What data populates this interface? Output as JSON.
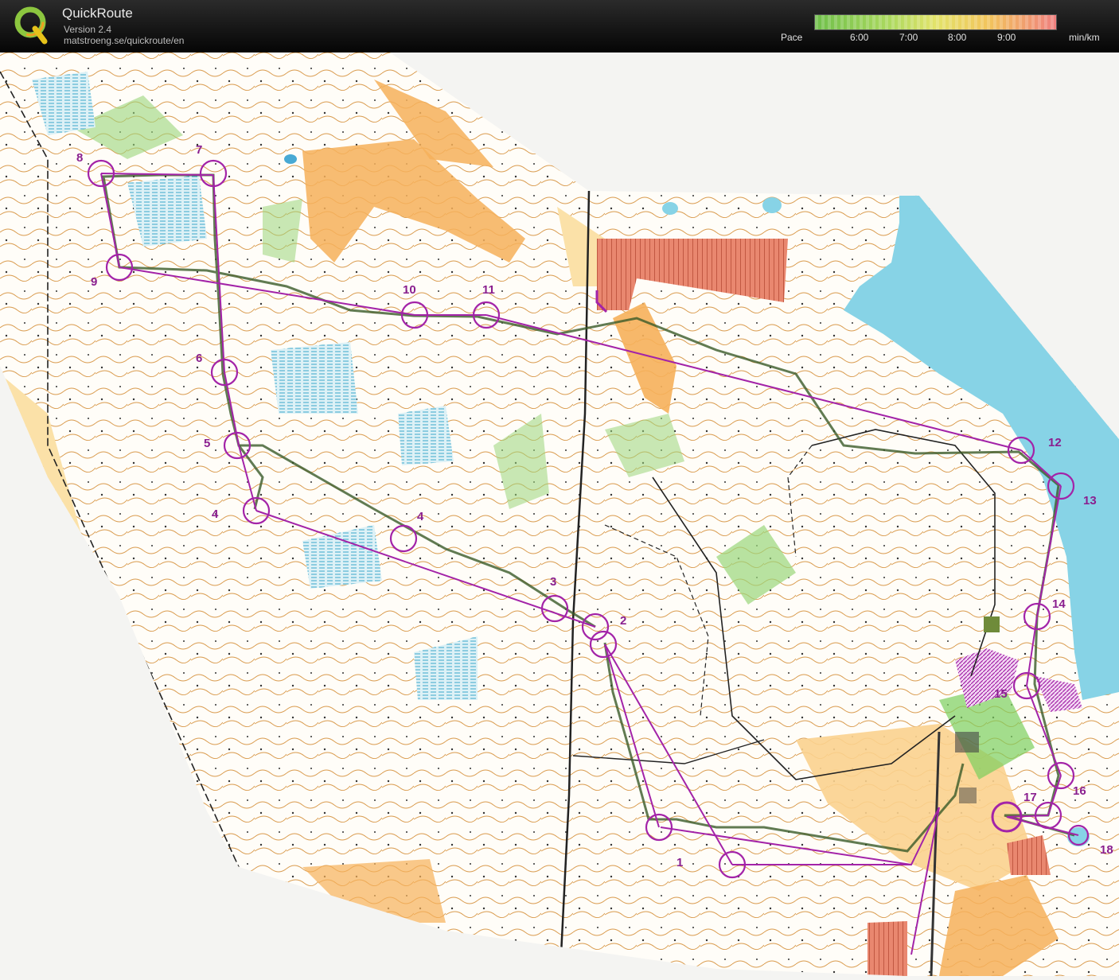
{
  "header": {
    "app_name": "QuickRoute",
    "version": "Version 2.4",
    "url": "matstroeng.se/quickroute/en"
  },
  "pace_legend": {
    "label": "Pace",
    "ticks": [
      "6:00",
      "7:00",
      "8:00",
      "9:00"
    ],
    "unit": "min/km",
    "colors": [
      "#6fbf4a",
      "#9fd45a",
      "#e3e36a",
      "#f2c45c",
      "#ef8f7f"
    ]
  },
  "map": {
    "colors": {
      "open_land": "#f6b05a",
      "rough_open": "#fbe1a8",
      "forest_white": "#ffffff",
      "green": "#9ad67a",
      "water": "#87d3e6",
      "marsh": "#b7e0ea",
      "contour": "#c9883a",
      "course": "#a323a8",
      "route": "#3a5a28"
    },
    "controls": [
      {
        "label": "1"
      },
      {
        "label": "2"
      },
      {
        "label": "3"
      },
      {
        "label": "4"
      },
      {
        "label": "4"
      },
      {
        "label": "5"
      },
      {
        "label": "6"
      },
      {
        "label": "7"
      },
      {
        "label": "8"
      },
      {
        "label": "9"
      },
      {
        "label": "10"
      },
      {
        "label": "11"
      },
      {
        "label": "12"
      },
      {
        "label": "13"
      },
      {
        "label": "14"
      },
      {
        "label": "15"
      },
      {
        "label": "16"
      },
      {
        "label": "17"
      },
      {
        "label": "18"
      }
    ]
  }
}
